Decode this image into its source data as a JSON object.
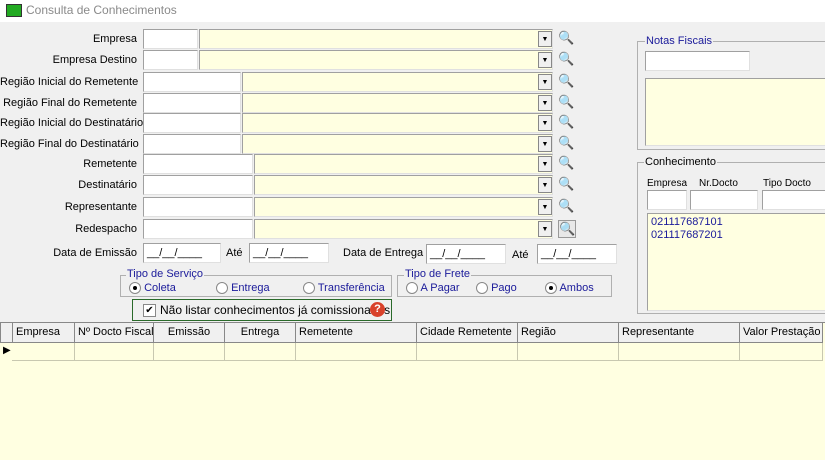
{
  "window": {
    "title": "Consulta de Conhecimentos"
  },
  "lookups": [
    {
      "label": "Empresa"
    },
    {
      "label": "Empresa Destino"
    },
    {
      "label": "Região Inicial do Remetente"
    },
    {
      "label": "Região Final do Remetente"
    },
    {
      "label": "Região  Inicial do Destinatário"
    },
    {
      "label": "Região Final do Destinatário"
    },
    {
      "label": "Remetente"
    },
    {
      "label": "Destinatário"
    },
    {
      "label": "Representante"
    },
    {
      "label": "Redespacho"
    }
  ],
  "dates": {
    "emissao_label": "Data de Emissão",
    "ate_label": "Até",
    "entrega_label": "Data de Entrega",
    "emissao_de": "__/__/____",
    "emissao_ate": "__/__/____",
    "entrega_de": "__/__/____",
    "entrega_ate": "__/__/____"
  },
  "tipo_servico": {
    "label": "Tipo de Serviço",
    "options": [
      "Coleta",
      "Entrega",
      "Transferência"
    ],
    "selected": "Coleta"
  },
  "tipo_frete": {
    "label": "Tipo de Frete",
    "options": [
      "A Pagar",
      "Pago",
      "Ambos"
    ],
    "selected": "Ambos"
  },
  "checkbox": {
    "label": "Não listar conhecimentos já comissionados",
    "checked": true,
    "help": "?"
  },
  "notas_fiscais": {
    "label": "Notas Fiscais"
  },
  "conhecimento": {
    "label": "Conhecimento",
    "col_empresa": "Empresa",
    "col_nrdocto": "Nr.Docto",
    "col_tipodocto": "Tipo Docto",
    "items": [
      "021117687101",
      "021117687201"
    ]
  },
  "grid": {
    "columns": [
      "Empresa",
      "Nº Docto Fiscal",
      "Emissão",
      "Entrega",
      "Remetente",
      "Cidade Remetente",
      "Região",
      "Representante",
      "Valor Prestação"
    ]
  }
}
